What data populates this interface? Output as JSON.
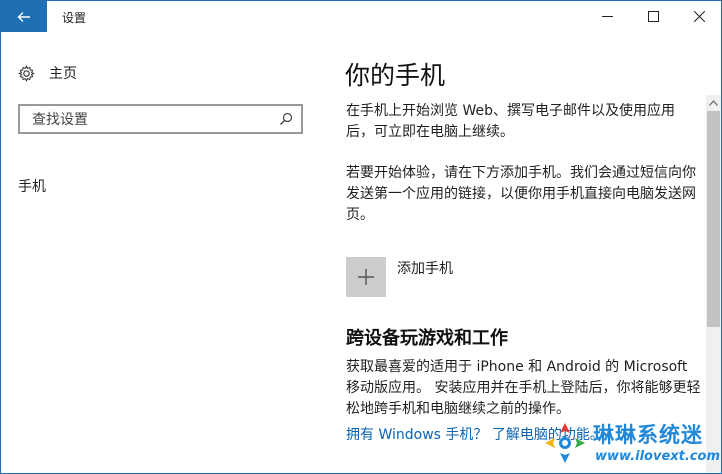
{
  "window": {
    "title": "设置"
  },
  "nav": {
    "home_label": "主页",
    "search_placeholder": "查找设置",
    "items": [
      {
        "label": "手机"
      }
    ]
  },
  "main": {
    "title": "你的手机",
    "para1": "在手机上开始浏览 Web、撰写电子邮件以及使用应用后，可立即在电脑上继续。",
    "para2": "若要开始体验，请在下方添加手机。我们会通过短信向你发送第一个应用的链接，以便你用手机直接向电脑发送网页。",
    "add_phone_label": "添加手机",
    "section_title": "跨设备玩游戏和工作",
    "para3": "获取最喜爱的适用于 iPhone 和 Android 的 Microsoft 移动版应用。 安装应用并在手机上登陆后，你将能够更轻松地跨手机和电脑继续之前的操作。",
    "link": "拥有 Windows 手机？ 了解电脑的功能。"
  },
  "watermark": {
    "brand": "琳琳系统迷",
    "url": "www.ilovext.com"
  },
  "colors": {
    "accent": "#1f6fb5",
    "link": "#0a63b5",
    "watermark": "#1f88d8"
  },
  "icons": {
    "back": "back-arrow-icon",
    "home": "gear-icon",
    "search": "search-icon",
    "add": "plus-icon",
    "minimize": "minimize-icon",
    "maximize": "maximize-icon",
    "close": "close-icon"
  }
}
